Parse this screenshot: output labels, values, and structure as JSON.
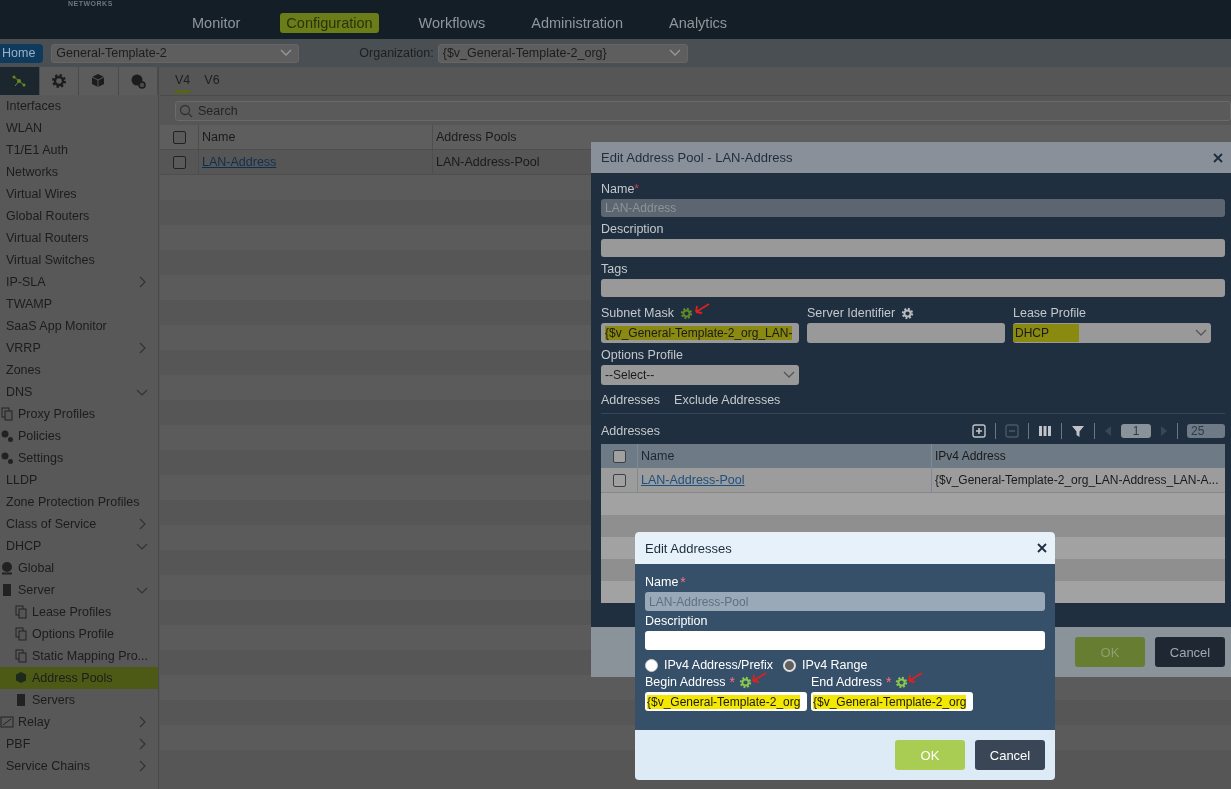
{
  "header": {
    "logo": "NETWORKS",
    "nav": [
      {
        "label": "Monitor",
        "selected": false
      },
      {
        "label": "Configuration",
        "selected": true
      },
      {
        "label": "Workflows",
        "selected": false
      },
      {
        "label": "Administration",
        "selected": false
      },
      {
        "label": "Analytics",
        "selected": false
      }
    ]
  },
  "toolbar": {
    "home": "Home",
    "template": "General-Template-2",
    "org_label": "Organization:",
    "org_value": "{$v_General-Template-2_org}"
  },
  "sidebar": {
    "icon_tabs": [
      {
        "kind": "network",
        "selected": true
      },
      {
        "kind": "gear",
        "selected": false
      },
      {
        "kind": "cube",
        "selected": false
      },
      {
        "kind": "globe",
        "selected": false
      }
    ],
    "items": [
      {
        "label": "Interfaces",
        "selected": false
      },
      {
        "label": "WLAN",
        "selected": false
      },
      {
        "label": "T1/E1 Auth",
        "selected": false
      },
      {
        "label": "Networks",
        "selected": false
      },
      {
        "label": "Virtual Wires",
        "selected": false
      },
      {
        "label": "Global Routers",
        "selected": false
      },
      {
        "label": "Virtual Routers",
        "selected": false
      },
      {
        "label": "Virtual Switches",
        "selected": false
      },
      {
        "label": "IP-SLA",
        "selected": false,
        "expanded": false
      },
      {
        "label": "TWAMP",
        "selected": false
      },
      {
        "label": "SaaS App Monitor",
        "selected": false
      },
      {
        "label": "VRRP",
        "selected": false,
        "expanded": false
      },
      {
        "label": "Zones",
        "selected": false
      },
      {
        "label": "DNS",
        "selected": false,
        "expanded": true,
        "children": [
          {
            "label": "Proxy Profiles",
            "kind": "doc",
            "selected": false
          },
          {
            "label": "Policies",
            "kind": "gears",
            "selected": false
          },
          {
            "label": "Settings",
            "kind": "gears",
            "selected": false
          }
        ]
      },
      {
        "label": "LLDP",
        "selected": false
      },
      {
        "label": "Zone Protection Profiles",
        "selected": false
      },
      {
        "label": "Class of Service",
        "selected": false,
        "expanded": false
      },
      {
        "label": "DHCP",
        "selected": false,
        "expanded": true,
        "children": [
          {
            "label": "Global",
            "kind": "globe",
            "selected": false
          },
          {
            "label": "Server",
            "kind": "server",
            "selected": false,
            "expanded": true,
            "children": [
              {
                "label": "Lease Profiles",
                "kind": "doc",
                "selected": false
              },
              {
                "label": "Options Profile",
                "kind": "doc",
                "selected": false
              },
              {
                "label": "Static Mapping Pro...",
                "kind": "doc",
                "selected": false
              },
              {
                "label": "Address Pools",
                "kind": "cube",
                "selected": true
              },
              {
                "label": "Servers",
                "kind": "server",
                "selected": false
              }
            ]
          },
          {
            "label": "Relay",
            "kind": "relay",
            "selected": false,
            "expanded": false
          }
        ]
      },
      {
        "label": "PBF",
        "selected": false,
        "expanded": false
      },
      {
        "label": "Service Chains",
        "selected": false,
        "expanded": false
      }
    ]
  },
  "tabs": [
    {
      "label": "V4",
      "selected": true
    },
    {
      "label": "V6",
      "selected": false
    }
  ],
  "search": {
    "placeholder": "Search"
  },
  "table": {
    "all_checked": false,
    "columns": [
      "Name",
      "Address Pools"
    ],
    "rows": [
      {
        "checked": false,
        "cells": [
          "LAN-Address",
          "LAN-Address-Pool"
        ]
      }
    ]
  },
  "dialog": {
    "title": "Edit Address Pool - LAN-Address",
    "name_label": "Name",
    "required_mark": "*",
    "name_value": "LAN-Address",
    "description_label": "Description",
    "tags_label": "Tags",
    "fields": [
      {
        "label": "Subnet Mask",
        "kind": "text",
        "gear_active": true,
        "annotated": true,
        "highlighted": true,
        "value": "{$v_General-Template-2_org_LAN-"
      },
      {
        "label": "Server Identifier",
        "kind": "text",
        "gear_active": false,
        "annotated": false
      },
      {
        "label": "Lease Profile",
        "kind": "select",
        "highlighted": true,
        "value": "DHCP"
      }
    ],
    "options_label": "Options Profile",
    "options_value": "--Select--",
    "subtabs": [
      {
        "label": "Addresses"
      },
      {
        "label": "Exclude Addresses"
      }
    ],
    "grid_title": "Addresses",
    "page": "1",
    "page_size": "25",
    "grid": {
      "all_checked": false,
      "columns": [
        "Name",
        "IPv4 Address"
      ],
      "rows": [
        {
          "checked": false,
          "cells": [
            "LAN-Address-Pool",
            "{$v_General-Template-2_org_LAN-Address_LAN-A..."
          ]
        }
      ]
    },
    "buttons": [
      "OK",
      "Cancel"
    ]
  },
  "subdialog": {
    "title": "Edit Addresses",
    "name_label": "Name",
    "required_mark": "*",
    "name_value": "LAN-Address-Pool",
    "description_label": "Description",
    "radios": [
      {
        "label": "IPv4 Address/Prefix",
        "selected": false
      },
      {
        "label": "IPv4 Range",
        "selected": true
      }
    ],
    "fields": [
      {
        "label": "Begin Address",
        "required_mark": "*",
        "gear_active": true,
        "annotated": true,
        "highlighted": true,
        "value": "{$v_General-Template-2_org"
      },
      {
        "label": "End Address",
        "required_mark": "*",
        "gear_active": true,
        "annotated": true,
        "highlighted": true,
        "value": "{$v_General-Template-2_org"
      }
    ],
    "buttons": [
      "OK",
      "Cancel"
    ]
  }
}
